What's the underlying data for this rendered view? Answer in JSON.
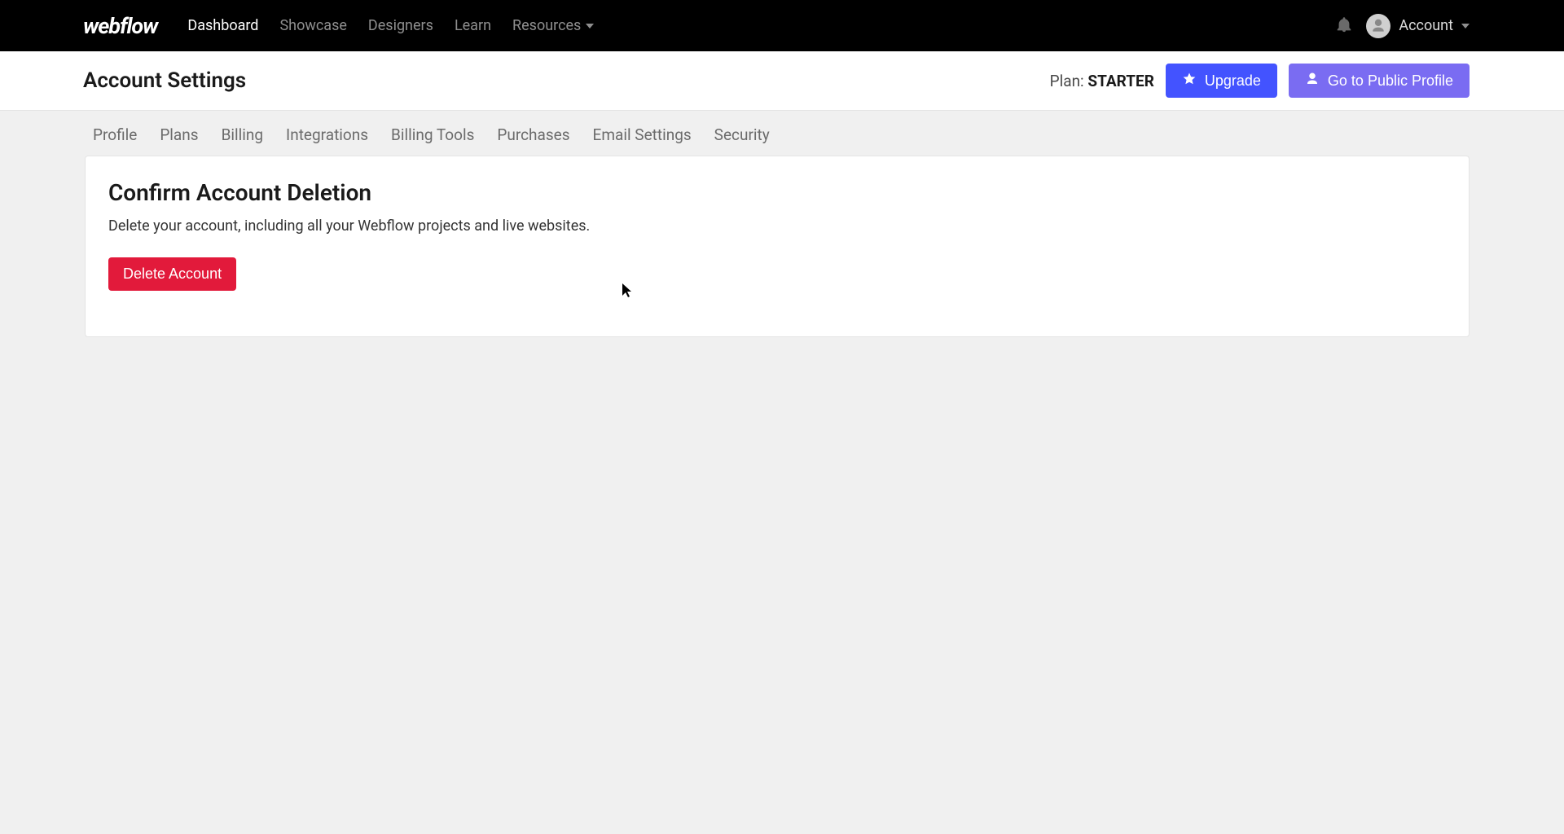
{
  "brand": "webflow",
  "nav": {
    "items": [
      {
        "label": "Dashboard",
        "active": true
      },
      {
        "label": "Showcase",
        "active": false
      },
      {
        "label": "Designers",
        "active": false
      },
      {
        "label": "Learn",
        "active": false
      },
      {
        "label": "Resources",
        "active": false,
        "hasChevron": true
      }
    ],
    "account_label": "Account"
  },
  "header": {
    "title": "Account Settings",
    "plan_prefix": "Plan: ",
    "plan_name": "STARTER",
    "upgrade_label": "Upgrade",
    "profile_label": "Go to Public Profile"
  },
  "tabs": [
    "Profile",
    "Plans",
    "Billing",
    "Integrations",
    "Billing Tools",
    "Purchases",
    "Email Settings",
    "Security"
  ],
  "card": {
    "title": "Confirm Account Deletion",
    "description": "Delete your account, including all your Webflow projects and live websites.",
    "delete_label": "Delete Account"
  }
}
